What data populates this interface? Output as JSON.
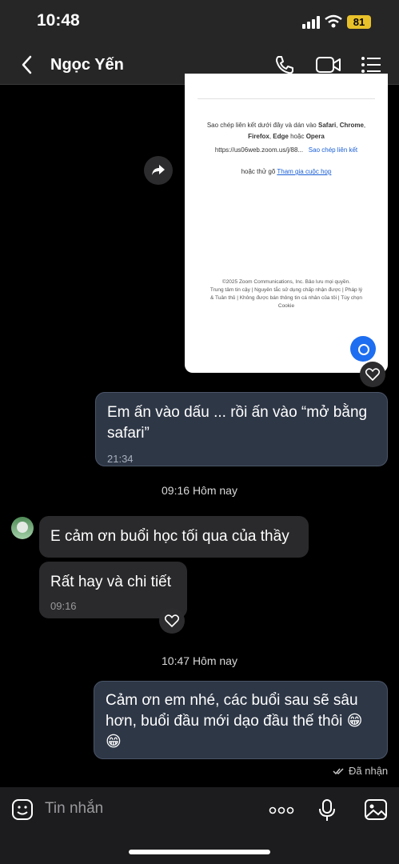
{
  "status_bar": {
    "time": "10:48",
    "battery": "81"
  },
  "header": {
    "contact_name": "Ngọc Yến"
  },
  "shared_image": {
    "line1_prefix": "Sao chép liên kết dưới đây và dán vào",
    "browser_safari": "Safari",
    "browser_chrome": "Chrome",
    "browser_firefox": "Firefox",
    "browser_edge": "Edge",
    "or_word": "hoặc",
    "browser_opera": "Opera",
    "link_url": "https://us06web.zoom.us/j/88...",
    "copy_link": "Sao chép liên kết",
    "or_try": "hoặc thử gõ",
    "join_meeting": "Tham gia cuộc họp",
    "footer_line1": "©2025 Zoom Communications, Inc. Bảo lưu mọi quyền.",
    "footer_line2": "Trung tâm tin cậy | Nguyên tắc sử dụng chấp nhận được | Pháp lý",
    "footer_line3": "& Tuân thủ | Không được bán thông tin cá nhân của tôi | Tùy chọn",
    "footer_line4": "Cookie"
  },
  "messages": {
    "m1": {
      "text": "Em ấn vào dấu ... rồi ấn vào “mở bằng safari”",
      "time": "21:34"
    },
    "sep1": "09:16 Hôm nay",
    "m2": {
      "text": "E cảm ơn buổi học tối qua của thầy"
    },
    "m3": {
      "text": "Rất hay và chi tiết",
      "time": "09:16"
    },
    "sep2": "10:47 Hôm nay",
    "m4": {
      "text": "Cảm ơn em nhé, các buổi sau sẽ sâu hơn, buổi đầu mới dạo đầu thế thôi 😁 😁"
    },
    "status": "Đã nhận"
  },
  "composer": {
    "placeholder": "Tin nhắn"
  }
}
